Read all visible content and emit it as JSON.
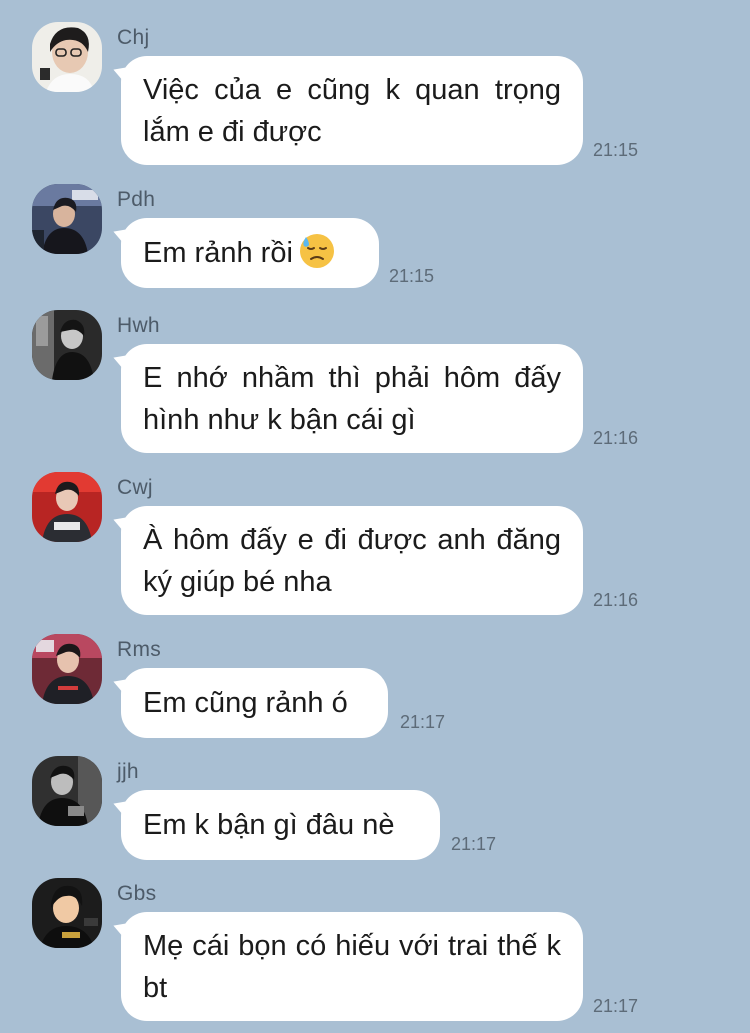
{
  "messages": [
    {
      "sender": "Chj",
      "text": "Việc của e cũng k quan trọng lắm e đi được",
      "time": "21:15"
    },
    {
      "sender": "Pdh",
      "text": "Em rảnh rồi",
      "emoji": "downcast-face-with-sweat",
      "time": "21:15"
    },
    {
      "sender": "Hwh",
      "text": "E nhớ nhầm thì phải hôm đấy hình như k bận cái gì",
      "time": "21:16"
    },
    {
      "sender": "Cwj",
      "text": "À hôm đấy e đi được anh đăng ký giúp bé nha",
      "time": "21:16"
    },
    {
      "sender": "Rms",
      "text": "Em cũng rảnh ó",
      "time": "21:17"
    },
    {
      "sender": "jjh",
      "text": "Em k bận gì đâu nè",
      "time": "21:17"
    },
    {
      "sender": "Gbs",
      "text": "Mẹ cái bọn có hiếu với trai thế k bt",
      "time": "21:17"
    }
  ],
  "colors": {
    "background": "#a9bfd3",
    "bubble": "#ffffff",
    "sender_text": "#4d5b69",
    "time_text": "#5d6b78"
  }
}
